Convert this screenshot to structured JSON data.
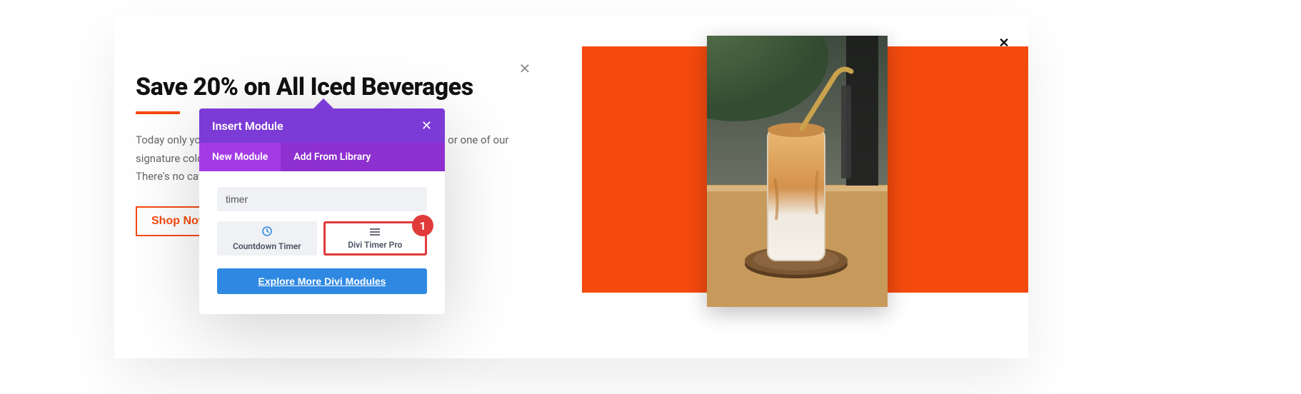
{
  "close_outer_glyph": "✕",
  "page_close_glyph": "✕",
  "promo": {
    "title": "Save 20% on All Iced Beverages",
    "body_line1": "Today only you can enjoy your favorite iced coffee, iced espresso, or one of our signature cold brews.",
    "body_line2": "There's no catch, it's just that hot today.",
    "shop_label": "Shop Now"
  },
  "popover": {
    "title": "Insert Module",
    "close_glyph": "✕",
    "tabs": {
      "new": "New Module",
      "library": "Add From Library"
    },
    "search_value": "timer",
    "modules": {
      "countdown": {
        "label": "Countdown Timer"
      },
      "divi_timer": {
        "label": "Divi Timer Pro"
      }
    },
    "badge": "1",
    "explore_label": "Explore More Divi Modules"
  },
  "colors": {
    "accent": "#f54a0e",
    "purple_header": "#7c3bd6",
    "purple_tabs": "#8e2fd0",
    "purple_active": "#a43ae6",
    "blue": "#2f89e3",
    "red": "#e03a3a"
  }
}
